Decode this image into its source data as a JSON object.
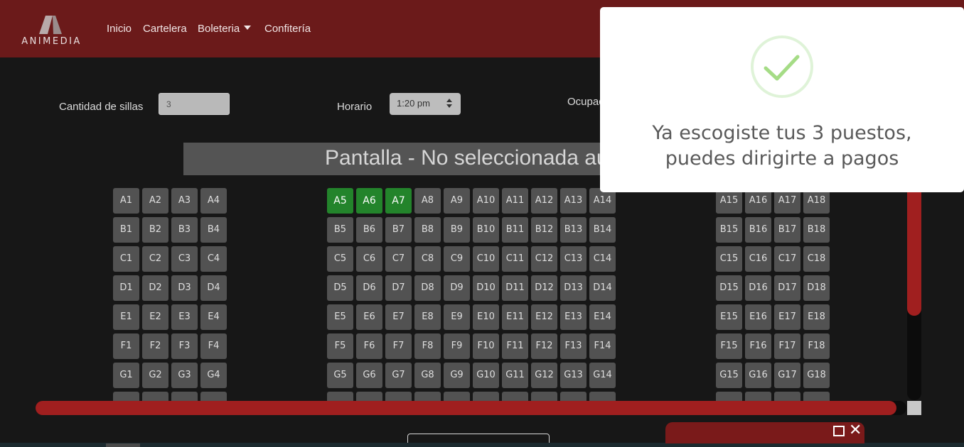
{
  "brand": {
    "name": "ANIMEDIA"
  },
  "nav": {
    "items": [
      {
        "label": "Inicio"
      },
      {
        "label": "Cartelera"
      },
      {
        "label": "Boleteria"
      },
      {
        "label": "Confitería"
      }
    ]
  },
  "controls": {
    "quantity_label": "Cantidad de sillas",
    "quantity_value": "3",
    "schedule_label": "Horario",
    "schedule_value": "1:20 pm",
    "occupied_label": "Ocupad"
  },
  "screen": {
    "label": "Pantalla - No seleccionada aú"
  },
  "seats": {
    "rows": [
      "A",
      "B",
      "C",
      "D",
      "E",
      "F",
      "G"
    ],
    "left_block": [
      1,
      2,
      3,
      4
    ],
    "center_block": [
      5,
      6,
      7,
      8,
      9,
      10,
      11,
      12,
      13,
      14
    ],
    "right_block": [
      15,
      16,
      17,
      18
    ],
    "selected": [
      "A5",
      "A6",
      "A7"
    ]
  },
  "modal": {
    "icon": "check-icon",
    "message": "Ya escogiste tus 3 puestos, puedes dirigirte a pagos"
  },
  "colors": {
    "navbar": "#6b1a1a",
    "seat": "#525252",
    "seat_selected": "#23842b",
    "scroll_thumb": "#a01f1f",
    "success": "#a5dc86"
  }
}
